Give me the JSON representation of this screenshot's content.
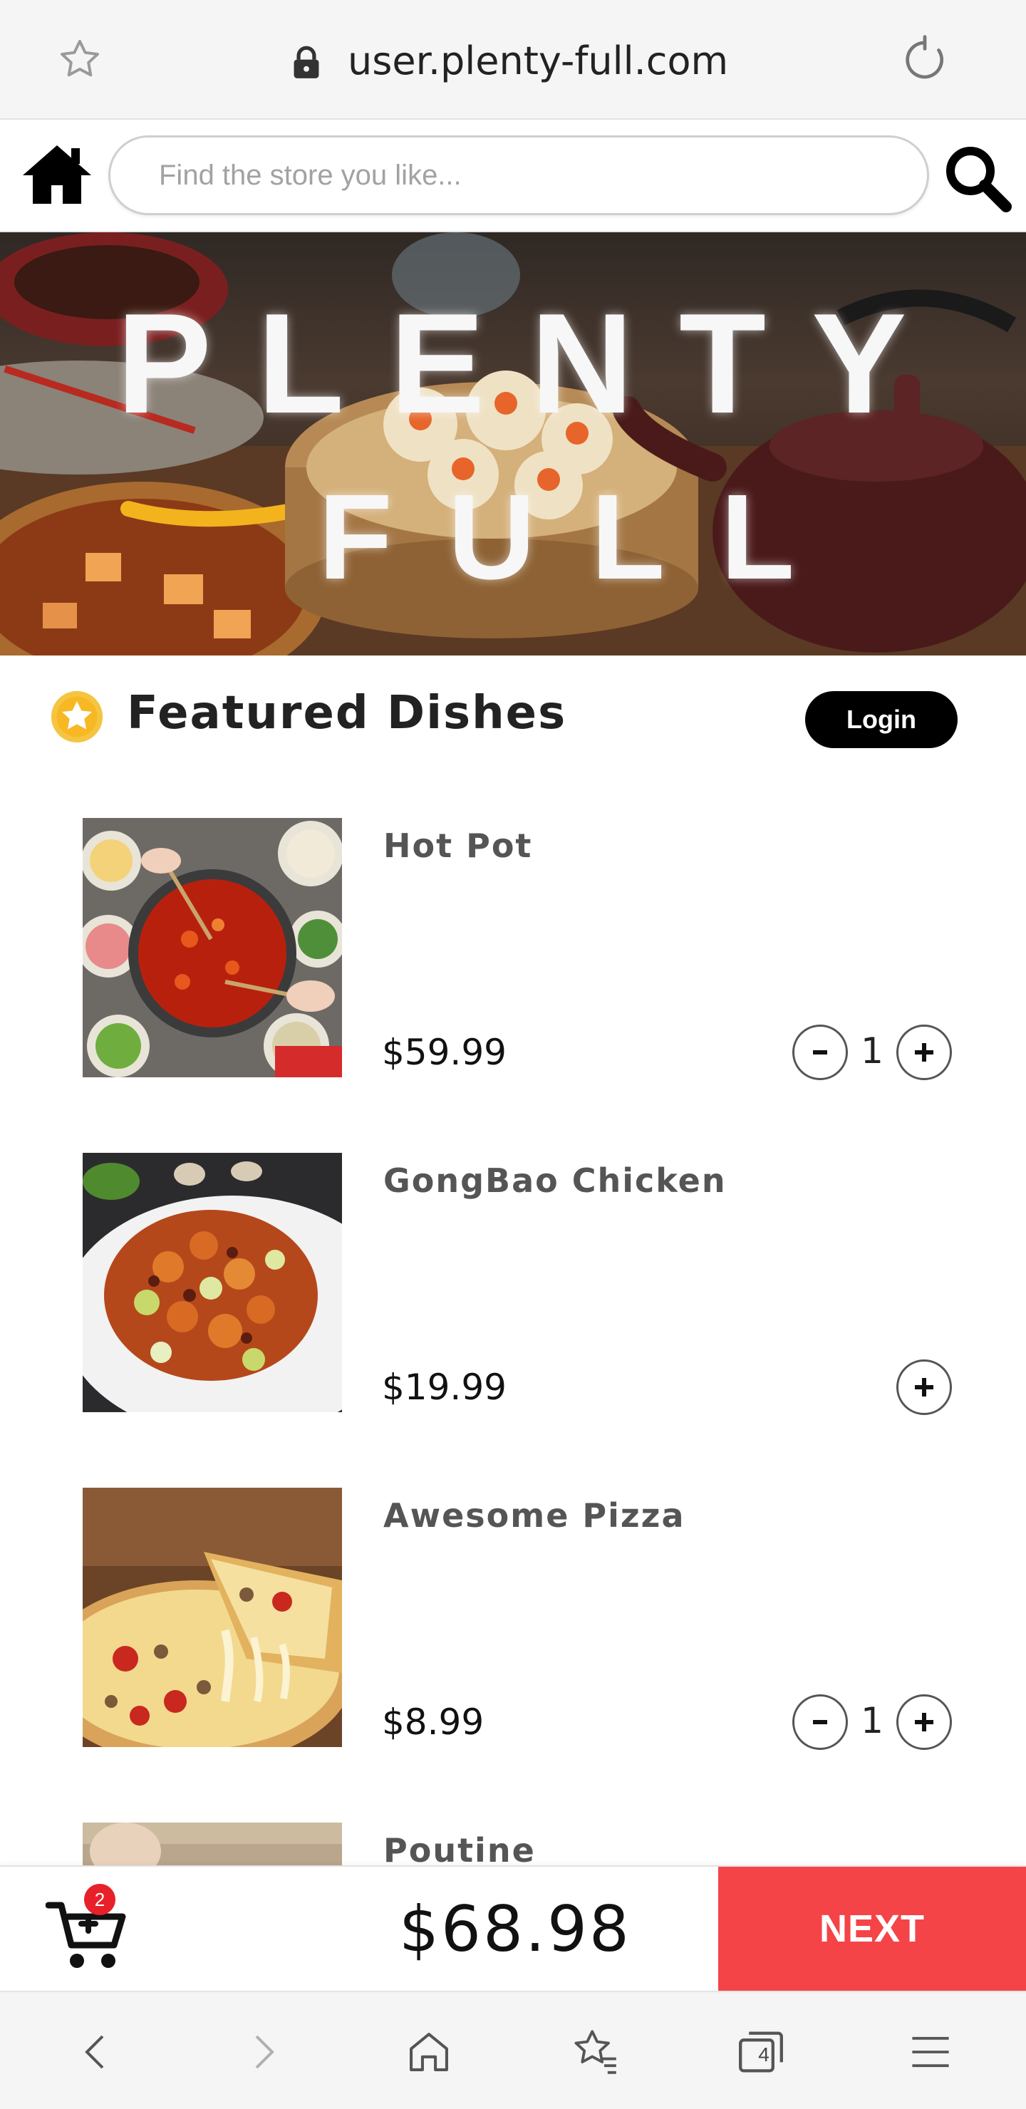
{
  "browser": {
    "url": "user.plenty-full.com",
    "tabs_count": "4"
  },
  "search": {
    "placeholder": "Find the store you like..."
  },
  "banner": {
    "line1": "PLENTY",
    "line2": "FULL",
    "accent_color": "#f2b31d"
  },
  "featured": {
    "title": "Featured Dishes",
    "login_label": "Login"
  },
  "dishes": [
    {
      "name": "Hot Pot",
      "price": "$59.99",
      "quantity": "1"
    },
    {
      "name": "GongBao Chicken",
      "price": "$19.99",
      "quantity": ""
    },
    {
      "name": "Awesome Pizza",
      "price": "$8.99",
      "quantity": "1"
    },
    {
      "name": "Poutine"
    }
  ],
  "cart": {
    "badge_count": "2",
    "total": "$68.98",
    "next_label": "NEXT",
    "next_color": "#f44448"
  },
  "icons": {
    "bookmark": "star-outline-icon",
    "lock": "lock-icon",
    "reload": "reload-icon",
    "home": "home-icon",
    "search": "search-icon",
    "featured": "star-badge-icon",
    "cart": "cart-icon",
    "back": "chevron-left-icon",
    "forward": "chevron-right-icon",
    "bookmarks": "bookmarks-icon",
    "tabs": "tabs-icon",
    "menu": "menu-icon"
  }
}
